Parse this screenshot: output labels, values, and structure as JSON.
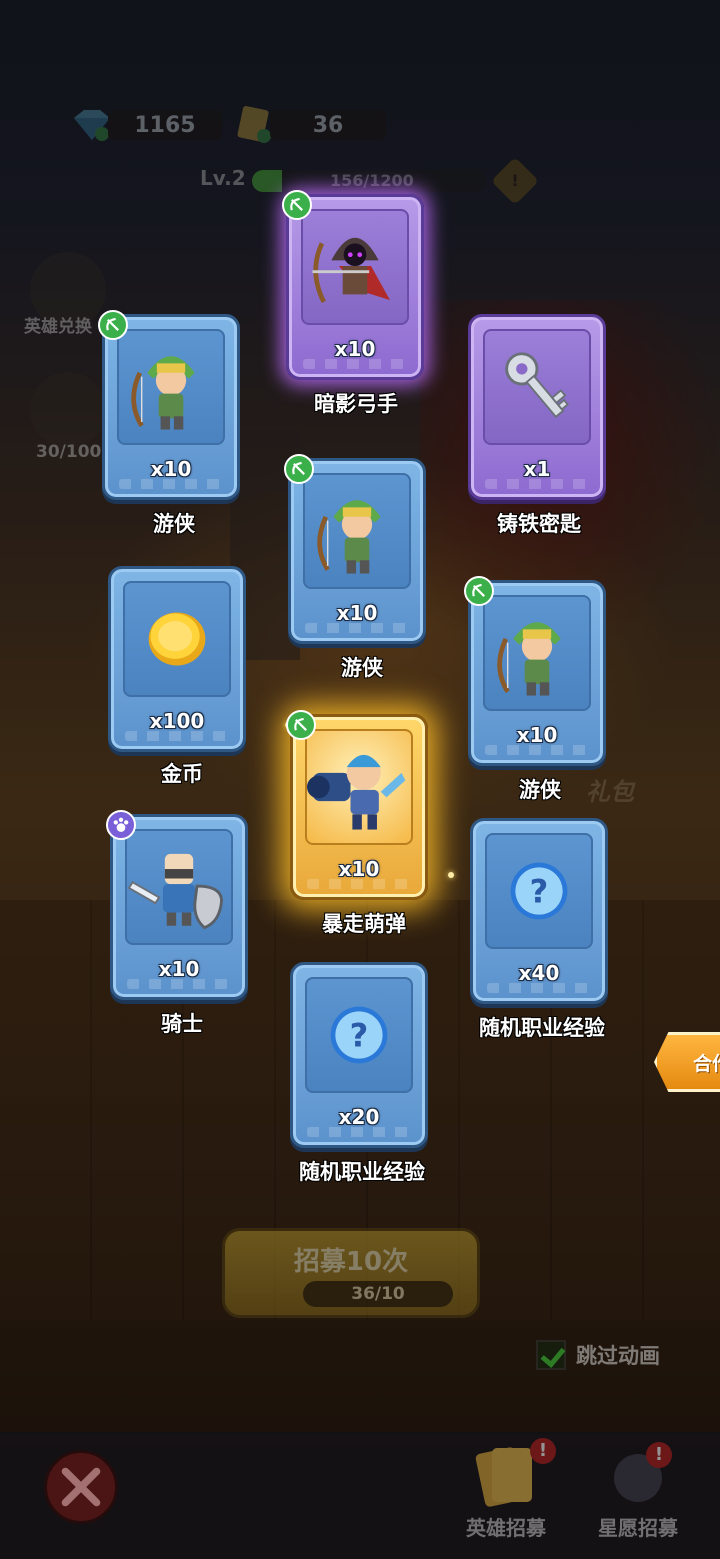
{
  "hud": {
    "gems": "1165",
    "tickets": "36",
    "level": "Lv.2",
    "xp_text": "156/1200",
    "xp_fraction": 0.13
  },
  "side": {
    "hero_exchange_label": "英雄兑换",
    "star_progress": "30/100"
  },
  "cards": [
    {
      "name": "暗影弓手",
      "qty": "x10",
      "art": "shadow-archer",
      "rarity": "purple",
      "badge": "bow"
    },
    {
      "name": "游侠",
      "qty": "x10",
      "art": "ranger",
      "rarity": "blue",
      "badge": "bow"
    },
    {
      "name": "铸铁密匙",
      "qty": "x1",
      "art": "iron-key",
      "rarity": "purple",
      "badge": ""
    },
    {
      "name": "游侠",
      "qty": "x10",
      "art": "ranger",
      "rarity": "blue",
      "badge": "bow"
    },
    {
      "name": "金币",
      "qty": "x100",
      "art": "gold-coin",
      "rarity": "blue",
      "badge": ""
    },
    {
      "name": "游侠",
      "qty": "x10",
      "art": "ranger",
      "rarity": "blue",
      "badge": "bow"
    },
    {
      "name": "暴走萌弹",
      "qty": "x10",
      "art": "cannon-hero",
      "rarity": "gold",
      "badge": "bow"
    },
    {
      "name": "骑士",
      "qty": "x10",
      "art": "knight",
      "rarity": "blue",
      "badge": "paw"
    },
    {
      "name": "随机职业经验",
      "qty": "x40",
      "art": "question-orb",
      "rarity": "blue",
      "badge": ""
    },
    {
      "name": "随机职业经验",
      "qty": "x20",
      "art": "question-orb",
      "rarity": "blue",
      "badge": ""
    }
  ],
  "bg_text": {
    "gift": "礼包"
  },
  "recruit": {
    "title": "招募10次",
    "count": "36/10"
  },
  "skip_animation": "跳过动画",
  "merge_label": "合作",
  "tabs": {
    "hero_recruit": "英雄招募",
    "star_recruit": "星愿招募"
  },
  "colors": {
    "blue_card": "#6fa6dc",
    "purple_card": "#a484df",
    "gold_card": "#f2c04f",
    "badge_green": "#3bb04a",
    "badge_purple": "#7a60d8"
  }
}
